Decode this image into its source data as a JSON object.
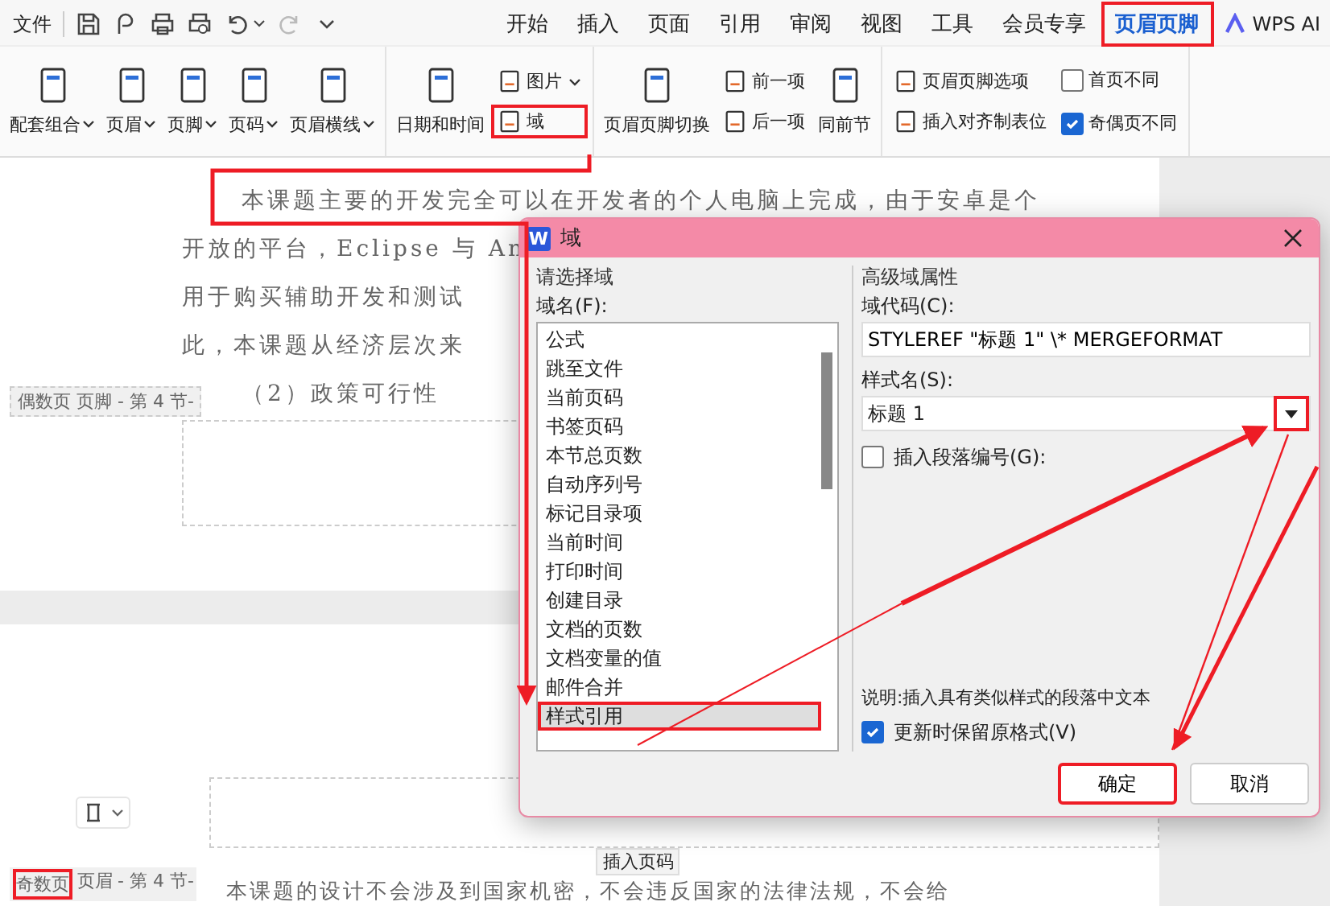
{
  "menu": {
    "file_label": "文件"
  },
  "tabs": [
    {
      "label": "开始",
      "selected": false,
      "highlighted": false
    },
    {
      "label": "插入",
      "selected": false,
      "highlighted": false
    },
    {
      "label": "页面",
      "selected": false,
      "highlighted": false
    },
    {
      "label": "引用",
      "selected": false,
      "highlighted": false
    },
    {
      "label": "审阅",
      "selected": false,
      "highlighted": false
    },
    {
      "label": "视图",
      "selected": false,
      "highlighted": false
    },
    {
      "label": "工具",
      "selected": false,
      "highlighted": false
    },
    {
      "label": "会员专享",
      "selected": false,
      "highlighted": false
    },
    {
      "label": "页眉页脚",
      "selected": true,
      "highlighted": true
    }
  ],
  "ai_button": "WPS AI",
  "ribbon": [
    {
      "items": [
        {
          "kind": "large",
          "label": "配套组合",
          "dropdown": true,
          "highlighted": false
        },
        {
          "kind": "large",
          "label": "页眉",
          "dropdown": true,
          "highlighted": false
        },
        {
          "kind": "large",
          "label": "页脚",
          "dropdown": true,
          "highlighted": false
        },
        {
          "kind": "large",
          "label": "页码",
          "dropdown": true,
          "highlighted": false
        },
        {
          "kind": "large",
          "label": "页眉横线",
          "dropdown": true,
          "highlighted": false
        }
      ]
    },
    {
      "items": [
        {
          "kind": "large",
          "label": "日期和时间",
          "dropdown": false,
          "highlighted": false
        },
        {
          "kind": "small",
          "label": "图片",
          "dropdown": true,
          "highlighted": false
        },
        {
          "kind": "small",
          "label": "域",
          "dropdown": false,
          "highlighted": true
        }
      ]
    },
    {
      "items": [
        {
          "kind": "large",
          "label": "页眉页脚切换",
          "dropdown": false,
          "highlighted": false
        },
        {
          "kind": "small",
          "label": "前一项",
          "dropdown": false,
          "highlighted": false
        },
        {
          "kind": "small",
          "label": "后一项",
          "dropdown": false,
          "highlighted": false
        },
        {
          "kind": "large",
          "label": "同前节",
          "dropdown": false,
          "highlighted": false
        }
      ]
    },
    {
      "items": [
        {
          "kind": "small",
          "label": "页眉页脚选项",
          "dropdown": false,
          "highlighted": false
        },
        {
          "kind": "small",
          "label": "插入对齐制表位",
          "dropdown": false,
          "highlighted": false
        },
        {
          "kind": "check",
          "label": "首页不同",
          "checked": false,
          "highlighted": false
        },
        {
          "kind": "check",
          "label": "奇偶页不同",
          "checked": true,
          "highlighted": false
        }
      ]
    }
  ],
  "document": {
    "page1_lines": [
      {
        "text": "本课题主要的开发完全可以在开发者的个人电脑上完成，由于安卓是个",
        "indent": true
      },
      {
        "text": "开放的平台，Eclipse 与 An",
        "indent": false
      },
      {
        "text": "用于购买辅助开发和测试",
        "indent": false
      },
      {
        "text": "此，本课题从经济层次来",
        "indent": false
      },
      {
        "text": "（2）政策可行性",
        "indent": true
      }
    ],
    "even_footer": {
      "page_type": "偶数页",
      "area": "页脚",
      "section": "- 第 4 节-",
      "highlighted": false
    },
    "odd_header": {
      "page_type": "奇数页",
      "area": "页眉",
      "section": "- 第 4 节-",
      "highlighted": true
    },
    "insert_page_number": "插入页码",
    "page2_line": "本课题的设计不会涉及到国家机密，不会违反国家的法律法规，不会给"
  },
  "dialog": {
    "app_logo": "W",
    "title": "域",
    "left_group": "请选择域",
    "field_names_label": "域名(F):",
    "fields": [
      {
        "label": "公式",
        "selected": false,
        "highlighted": false
      },
      {
        "label": "跳至文件",
        "selected": false,
        "highlighted": false
      },
      {
        "label": "当前页码",
        "selected": false,
        "highlighted": false
      },
      {
        "label": "书签页码",
        "selected": false,
        "highlighted": false
      },
      {
        "label": "本节总页数",
        "selected": false,
        "highlighted": false
      },
      {
        "label": "自动序列号",
        "selected": false,
        "highlighted": false
      },
      {
        "label": "标记目录项",
        "selected": false,
        "highlighted": false
      },
      {
        "label": "当前时间",
        "selected": false,
        "highlighted": false
      },
      {
        "label": "打印时间",
        "selected": false,
        "highlighted": false
      },
      {
        "label": "创建目录",
        "selected": false,
        "highlighted": false
      },
      {
        "label": "文档的页数",
        "selected": false,
        "highlighted": false
      },
      {
        "label": "文档变量的值",
        "selected": false,
        "highlighted": false
      },
      {
        "label": "邮件合并",
        "selected": false,
        "highlighted": false
      },
      {
        "label": "样式引用",
        "selected": true,
        "highlighted": true
      }
    ],
    "right_group": "高级域属性",
    "code_label": "域代码(C):",
    "code_value": "STYLEREF \"标题 1\" \\* MERGEFORMAT",
    "style_label": "样式名(S):",
    "style_value": "标题 1",
    "insert_numbering": {
      "label": "插入段落编号(G):",
      "checked": false
    },
    "description": "说明:插入具有类似样式的段落中文本",
    "keep_format": {
      "label": "更新时保留原格式(V)",
      "checked": true
    },
    "ok": {
      "label": "确定",
      "highlighted": true
    },
    "cancel": "取消"
  }
}
